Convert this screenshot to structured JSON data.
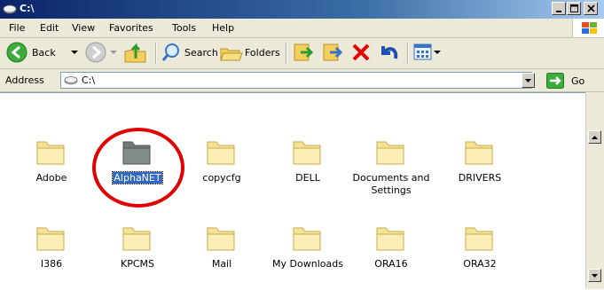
{
  "window": {
    "title": "C:\\"
  },
  "menu": {
    "file": "File",
    "edit": "Edit",
    "view": "View",
    "favorites": "Favorites",
    "tools": "Tools",
    "help": "Help"
  },
  "toolbar": {
    "back": "Back",
    "search": "Search",
    "folders": "Folders"
  },
  "address": {
    "label": "Address",
    "value": "C:\\",
    "go": "Go"
  },
  "folders": [
    {
      "name": "Adobe"
    },
    {
      "name": "AlphaNET",
      "selected": true
    },
    {
      "name": "copycfg"
    },
    {
      "name": "DELL"
    },
    {
      "name": "Documents and Settings"
    },
    {
      "name": "DRIVERS"
    },
    {
      "name": "I386"
    },
    {
      "name": "KPCMS"
    },
    {
      "name": "Mail"
    },
    {
      "name": "My Downloads"
    },
    {
      "name": "ORA16"
    },
    {
      "name": "ORA32"
    }
  ],
  "colors": {
    "folder": "#f6e39a",
    "folder_selected": "#6f7b78",
    "annotation": "#e00000",
    "selection": "#316ac5"
  }
}
